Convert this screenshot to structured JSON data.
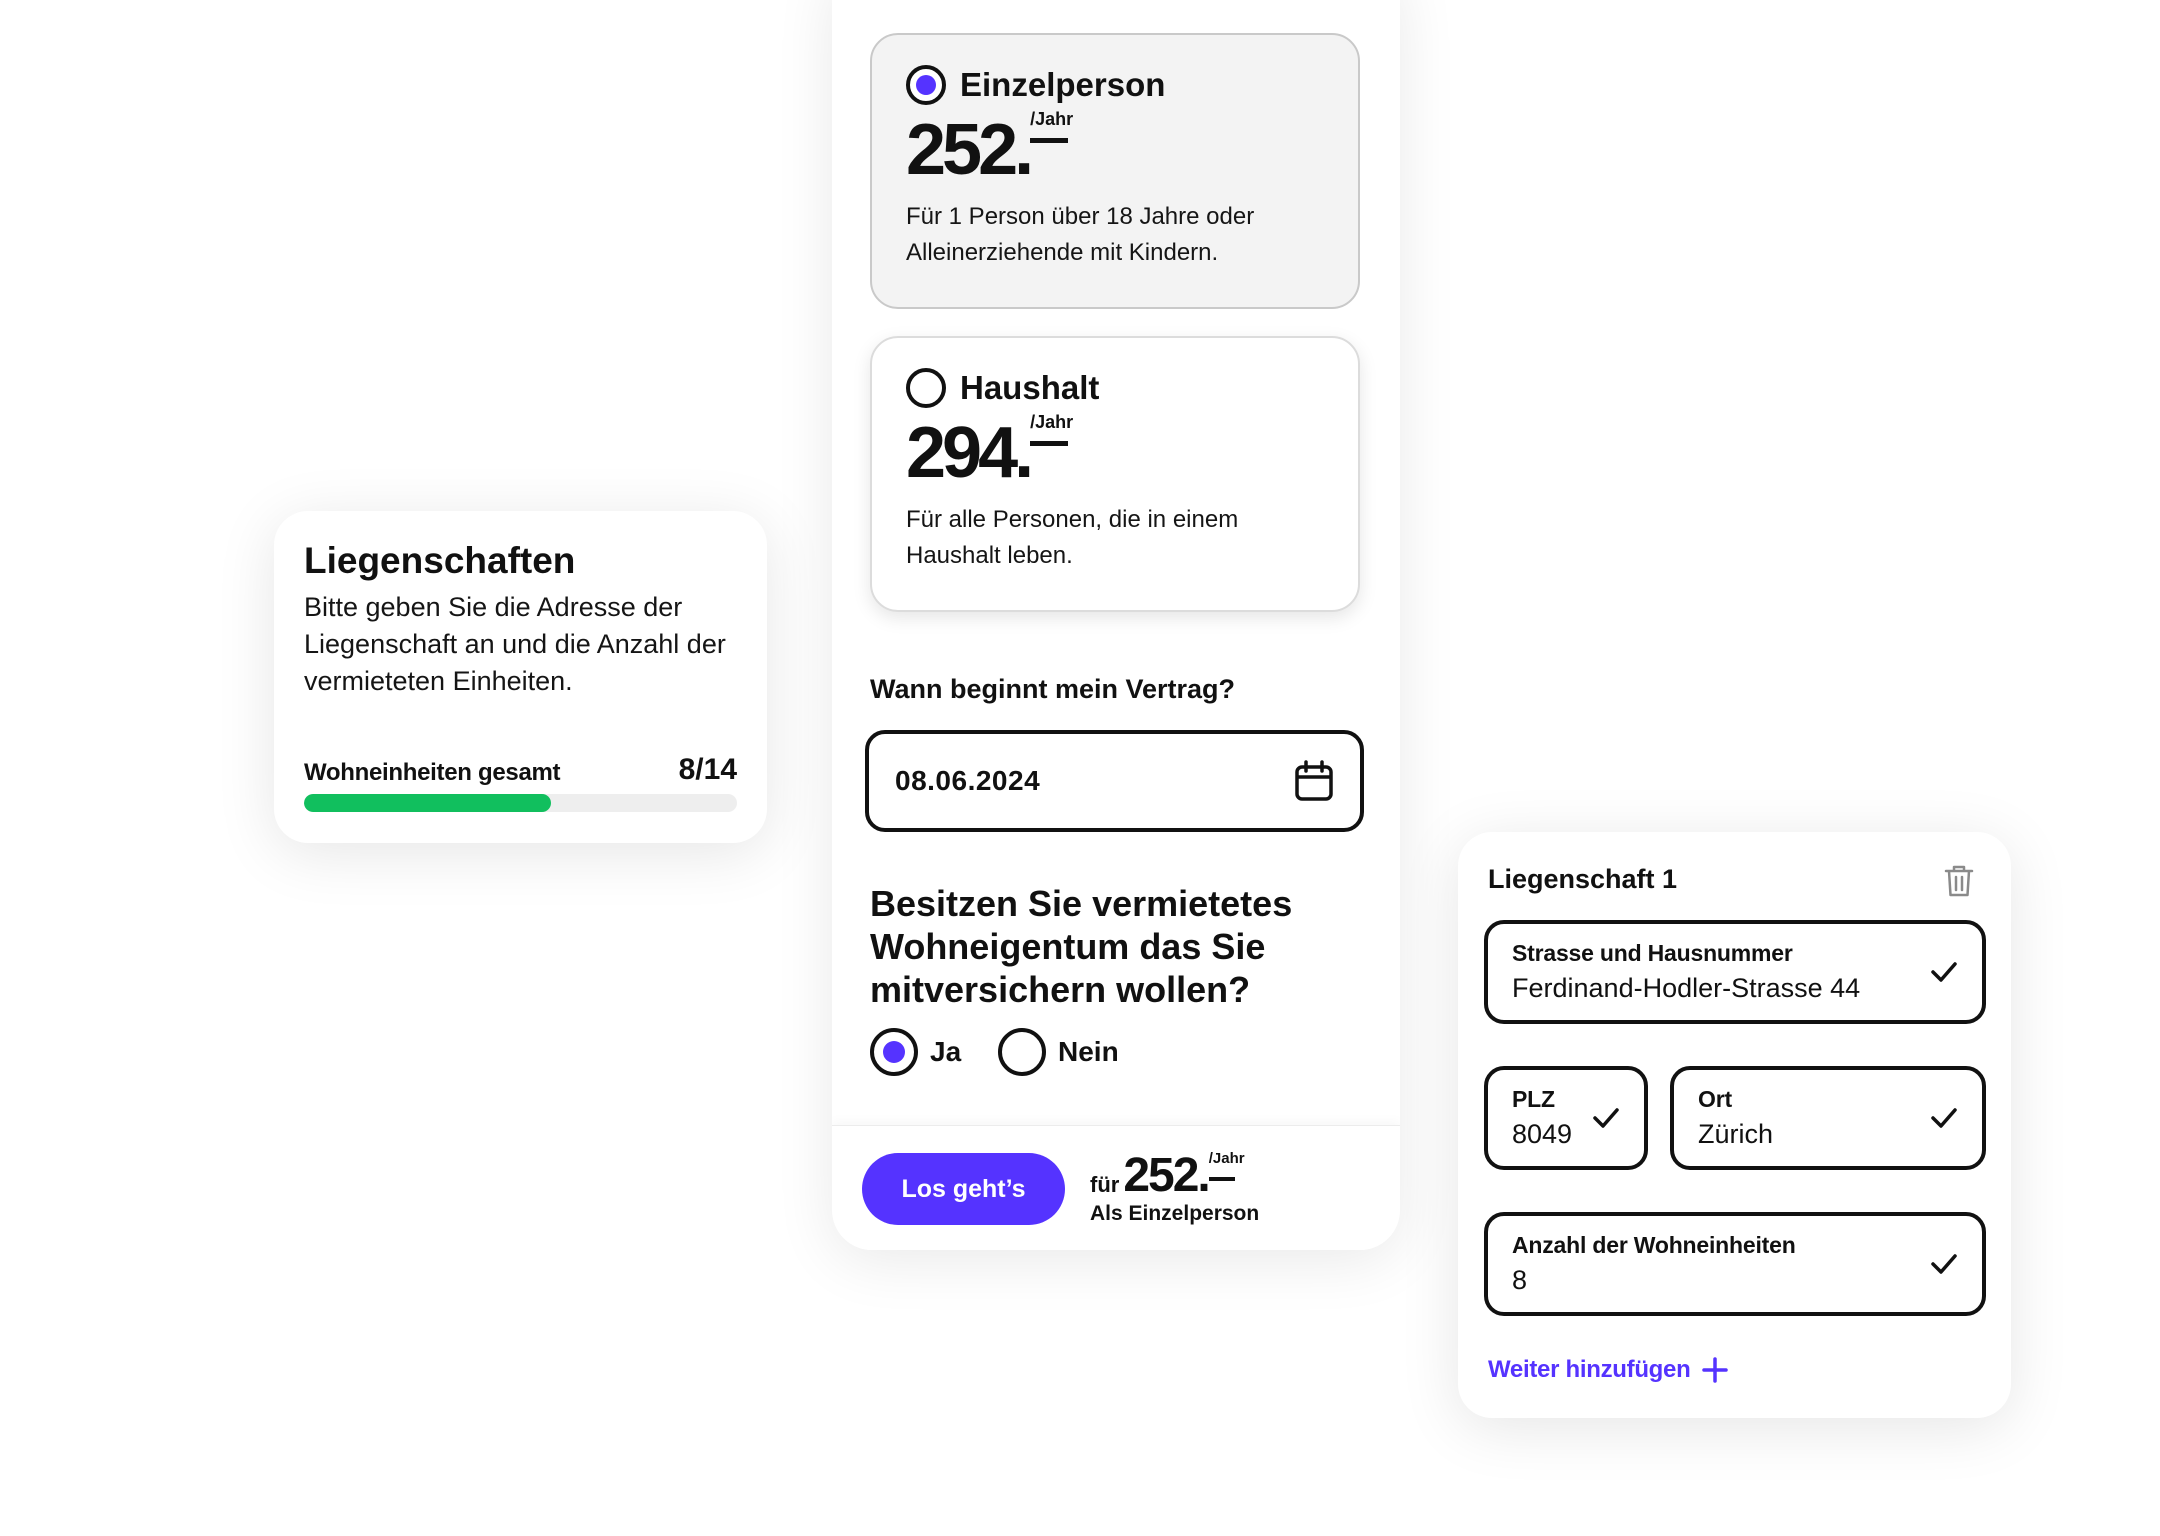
{
  "colors": {
    "accent": "#5533ff",
    "progress": "#11bf5e",
    "text": "#111111"
  },
  "left_card": {
    "title": "Liegenschaften",
    "description": "Bitte geben Sie die Adresse der Liegenschaft an und die Anzahl der vermieteten Einheiten.",
    "progress_label": "Wohneinheiten gesamt",
    "progress_count": "8/14",
    "progress_value": 8,
    "progress_max": 14
  },
  "plans": [
    {
      "name": "Einzelperson",
      "price": "252.",
      "per": "/Jahr",
      "description": "Für 1 Person über 18 Jahre oder Alleinerziehende mit Kindern.",
      "selected": true
    },
    {
      "name": "Haushalt",
      "price": "294.",
      "per": "/Jahr",
      "description": "Für alle Personen, die in einem Haushalt leben.",
      "selected": false
    }
  ],
  "contract": {
    "label": "Wann beginnt mein Vertrag?",
    "date": "08.06.2024",
    "icon": "calendar-icon"
  },
  "rental_question": {
    "text": "Besitzen Sie vermietetes Wohneigentum das Sie mitversichern wollen?",
    "options": [
      {
        "label": "Ja",
        "selected": true
      },
      {
        "label": "Nein",
        "selected": false
      }
    ]
  },
  "footer": {
    "cta_label": "Los geht’s",
    "price_prefix": "für",
    "price": "252.",
    "per": "/Jahr",
    "plan_label": "Als Einzelperson"
  },
  "right_card": {
    "title": "Liegenschaft 1",
    "delete_icon": "trash-icon",
    "fields": {
      "street": {
        "label": "Strasse und Hausnummer",
        "value": "Ferdinand-Hodler-Strasse 44"
      },
      "zip": {
        "label": "PLZ",
        "value": "8049"
      },
      "city": {
        "label": "Ort",
        "value": "Zürich"
      },
      "units": {
        "label": "Anzahl der Wohneinheiten",
        "value": "8"
      }
    },
    "add_label": "Weiter hinzufügen",
    "add_icon": "plus-icon"
  }
}
